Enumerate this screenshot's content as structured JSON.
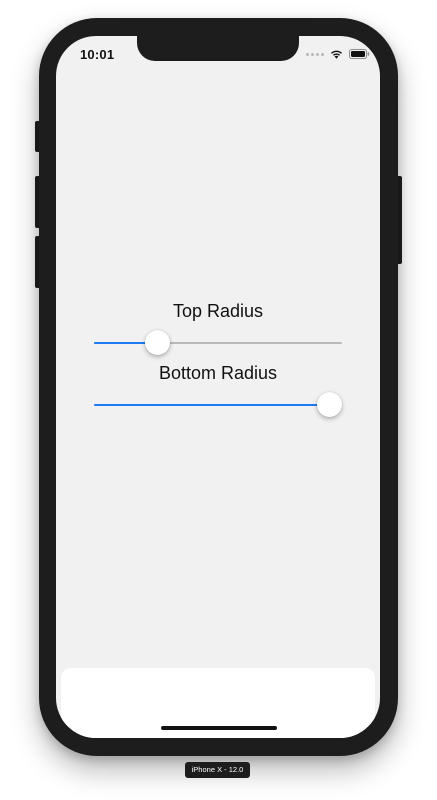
{
  "status_bar": {
    "time": "10:01",
    "signal_icon": "signal-dots-icon",
    "wifi_icon": "wifi-icon",
    "battery_icon": "battery-icon"
  },
  "sliders": [
    {
      "label": "Top Radius",
      "value": 0.23
    },
    {
      "label": "Bottom Radius",
      "value": 1.0
    }
  ],
  "colors": {
    "accent": "#1e7bf2",
    "track": "#b9b9b9",
    "screen_background": "#f1f1f1",
    "device_frame": "#1d1d1d"
  },
  "simulator": {
    "device_label": "iPhone X - 12.0"
  }
}
